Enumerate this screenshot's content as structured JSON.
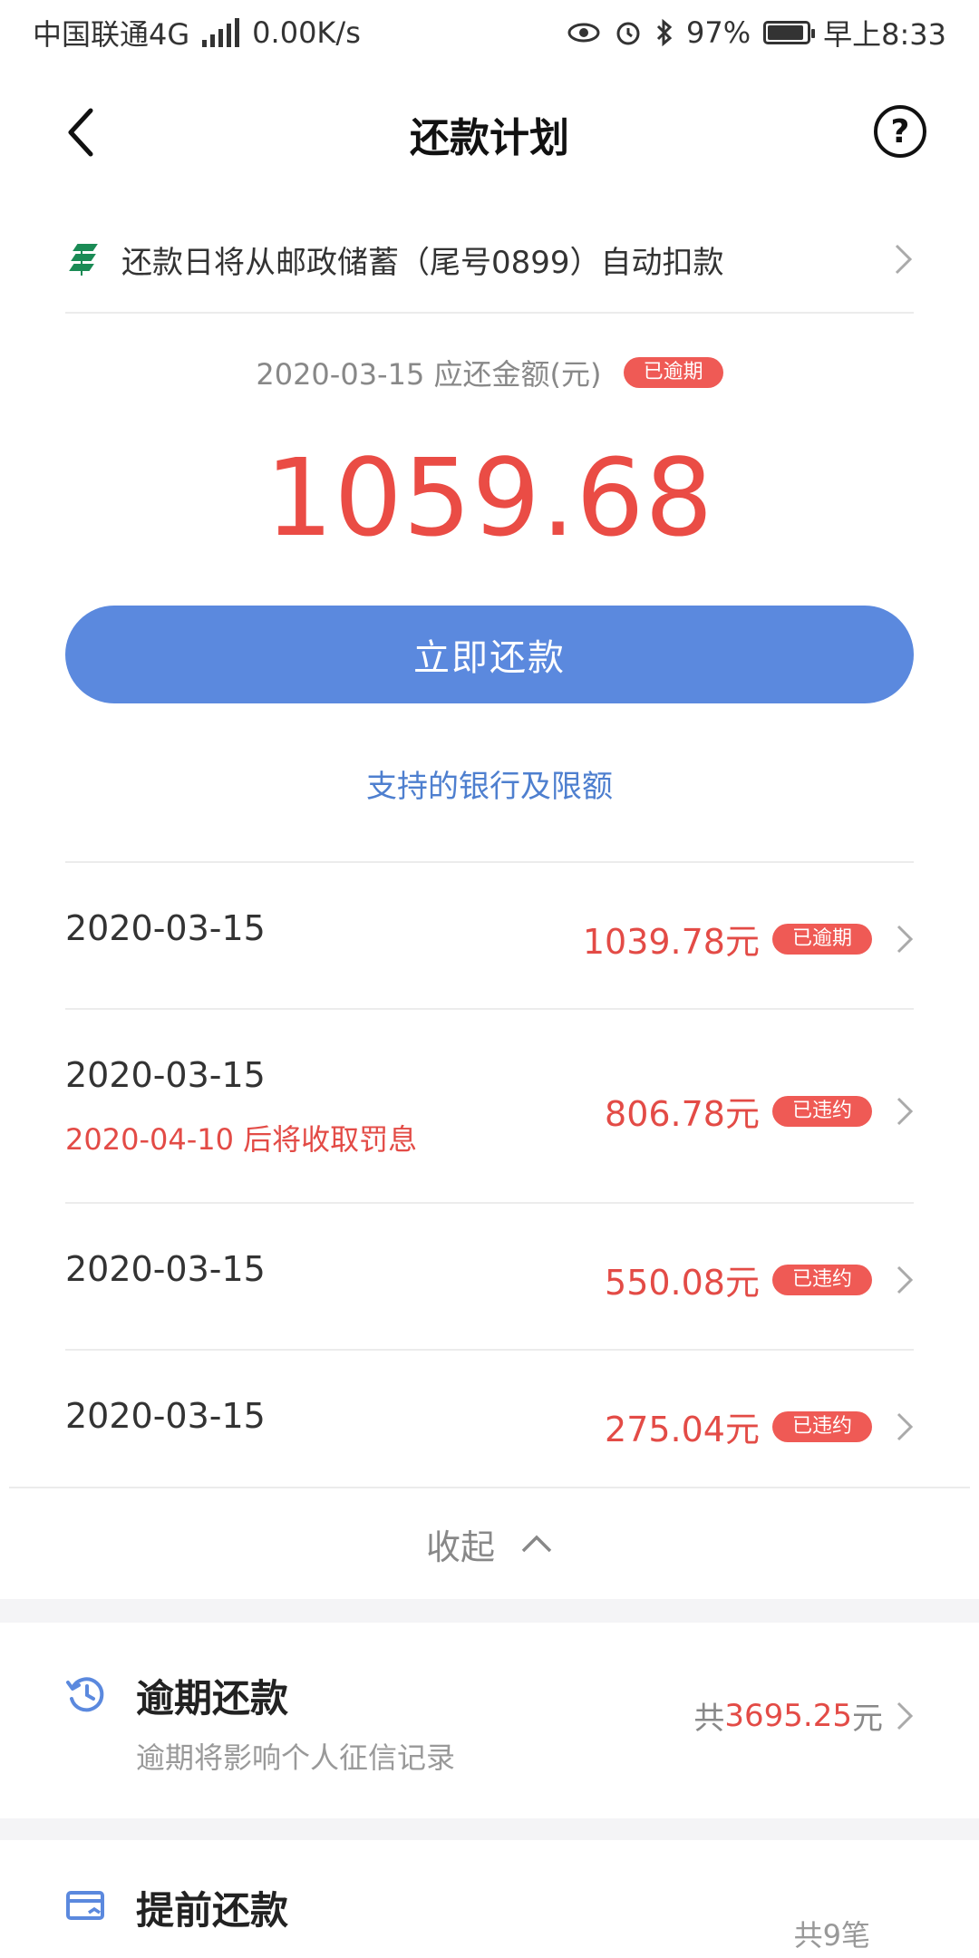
{
  "status_bar": {
    "carrier": "中国联通4G",
    "net_speed": "0.00K/s",
    "battery": "97%",
    "battery_level": 0.97,
    "time": "早上8:33"
  },
  "header": {
    "title": "还款计划"
  },
  "autopay": {
    "text": "还款日将从邮政储蓄（尾号0899）自动扣款"
  },
  "due": {
    "label": "2020-03-15 应还金额(元)",
    "status": "已逾期",
    "amount": "1059.68"
  },
  "pay_button_label": "立即还款",
  "bank_link": "支持的银行及限额",
  "plan": [
    {
      "date": "2020-03-15",
      "note": "",
      "amount": "1039.78元",
      "status": "已逾期"
    },
    {
      "date": "2020-03-15",
      "note": "2020-04-10 后将收取罚息",
      "amount": "806.78元",
      "status": "已违约"
    },
    {
      "date": "2020-03-15",
      "note": "",
      "amount": "550.08元",
      "status": "已违约"
    },
    {
      "date": "2020-03-15",
      "note": "",
      "amount": "275.04元",
      "status": "已违约"
    }
  ],
  "collapse_label": "收起",
  "overdue": {
    "title": "逾期还款",
    "subtitle": "逾期将影响个人征信记录",
    "total_prefix": "共",
    "total": "3695.25",
    "total_suffix": "元"
  },
  "prepay": {
    "title": "提前还款",
    "count": "共9笔"
  },
  "colors": {
    "accent_blue": "#5b89de",
    "alert_red": "#ea4c45"
  }
}
